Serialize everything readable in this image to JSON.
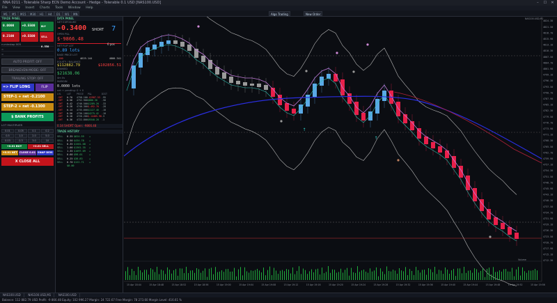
{
  "window": {
    "title": "NNA 0211 - Tolerable Sharp ECN Demo Account - Hedge - Tolerable 0.1 USD [NAS100.USD]",
    "controls": [
      "–",
      "☐",
      "✕"
    ]
  },
  "menu": [
    "File",
    "View",
    "Insert",
    "Charts",
    "Tools",
    "Window",
    "Help"
  ],
  "toolbar": {
    "timeframes": [
      "M1",
      "M5",
      "M15",
      "M30",
      "H1",
      "H4",
      "D1",
      "W1",
      "MN"
    ],
    "algo_label": "Algo Trading",
    "new_order_label": "New Order"
  },
  "left_panel": {
    "header": "TRADE PANEL",
    "quotes": [
      {
        "value": "0.0000",
        "change": "+0.5500",
        "btn": "BUY 0.550"
      },
      {
        "value": "0.2100",
        "change": "+0.5500",
        "btn": "SELL 0.550"
      }
    ],
    "lines": [
      "rr-minstop 005",
      "=",
      "="
    ],
    "auto_profit": "AUTO PROFIT: OFF",
    "breakeven": "BREAKEVEN MODE: OFF",
    "trailing": "TRAILING STOP: OFF",
    "flip_long": "=> FLIP LONG",
    "flip_extra": "FLIP",
    "step1": "STEP-1 + net -0.2100",
    "step2": "STEP-2 + net -0.1300",
    "bank_profits": "$ BANK PROFITS",
    "lot_label": "LOT MULTIPLIER",
    "lot_tiles": [
      "0.01",
      "0.05",
      "0.1",
      "0.2",
      "0.5",
      "1.0",
      "2.0",
      "5.0",
      "0.03",
      "0.3",
      "3.0",
      "10"
    ],
    "small_btns": [
      {
        "label": "+0.01 BUY",
        "color": "#0f7a3a"
      },
      {
        "label": "+0.01 SELL",
        "color": "#b8151c"
      }
    ],
    "small_btns2": [
      {
        "label": "+0.01 NET",
        "color": "#c78a12"
      },
      {
        "label": "CLOSE 0.01",
        "color": "#5a2d9a"
      },
      {
        "label": "SNAP DEIS",
        "color": "#2d37c8"
      }
    ],
    "close_all": "X CLOSE ALL"
  },
  "data_panel": {
    "header": "DATA PANEL",
    "net_label": "NET EXPOSURE",
    "net_value": "-0.3400",
    "side": "SHORT",
    "positions": "7",
    "open_pnl_label": "OPEN P&L",
    "open_pnl": "$-9866.48",
    "pnl_unit": "6 pos",
    "lots_label": "NET FLIP LOT",
    "lots": "0.89 lots",
    "lots_sub": "BASE PRICE LOT",
    "range_row": [
      "-100",
      "4619.144",
      "4800.341"
    ],
    "equity_label": "EQUITY / BALANCE",
    "equity": "$112882.79",
    "balance": "$102856.51",
    "bank_label": "BANKED",
    "bank": "$21638.06",
    "bank_sub": "4m 0s",
    "margin_label": "MARGIN",
    "margin": "0.0000 lots",
    "margin_sub": "net + pending: 0 + 0",
    "ladder_header": [
      "LVL",
      "LOT",
      "PRICE",
      "P&L",
      "DIST"
    ],
    "ladder": [
      [
        "-SHT",
        "0.70",
        "4758.100",
        "-$1987.53",
        "-95"
      ],
      [
        "-SHT",
        "0.56",
        "4752.900",
        "$886.30",
        "-58"
      ],
      [
        "-SHT",
        "0.42",
        "4746.500",
        "$1289.20",
        "-33"
      ],
      [
        "-SHT",
        "0.28",
        "4740.300",
        "$-492.70",
        "-28"
      ],
      [
        "-SHT",
        "0.14",
        "4735.600",
        "$1127.40",
        "-18"
      ],
      [
        "-SHT",
        "0.50",
        "4730.100",
        "$4275.42",
        "-10"
      ],
      [
        "-SHT",
        "0.10",
        "4726.200",
        "$-14485.98",
        "-3"
      ],
      [
        "-SHT",
        "0.36",
        "4722.800",
        "$9340.28",
        "-1"
      ]
    ],
    "short_summary": "0.34 SHORT   Open: -9866.48",
    "history_header": "TRADE HISTORY",
    "history": [
      [
        "SELL",
        "0.35",
        "$624.59",
        "+"
      ],
      [
        "SELL",
        "0.50",
        "$434.78",
        "+"
      ],
      [
        "SELL",
        "0.35",
        "$1581.08",
        "+"
      ],
      [
        "SELL",
        "1.00",
        "$1361.35",
        "+"
      ],
      [
        "SELL",
        "1.35",
        "$1097.09",
        "+"
      ],
      [
        "SELL",
        "0.60",
        "$98.01",
        "+"
      ],
      [
        "SELL",
        "0.25",
        "$38.83",
        "+"
      ],
      [
        "SELL",
        "0.70",
        "$122.71",
        "+"
      ]
    ],
    "history_total": "$0.00"
  },
  "chart": {
    "price_labels": [
      "4824.30",
      "4821.50",
      "4818.70",
      "4815.90",
      "4813.10",
      "4810.30",
      "4807.50",
      "4804.70",
      "4801.90",
      "4799.10",
      "4796.30",
      "4793.50",
      "4790.70",
      "4787.90",
      "4785.10",
      "4782.30",
      "4779.50",
      "4776.70",
      "4773.90",
      "4771.10",
      "4768.30",
      "4765.50",
      "4762.70",
      "4759.90",
      "4757.10",
      "4754.30",
      "4751.50",
      "4748.70",
      "4745.90",
      "4743.10",
      "4740.30",
      "4737.50",
      "4734.70",
      "4731.90",
      "4729.10",
      "4726.30",
      "4723.50",
      "4720.70",
      "4717.90",
      "4715.10",
      "4712.30"
    ],
    "time_labels": [
      "15 Apr 18:44",
      "15 Apr 18:48",
      "15 Apr 18:52",
      "15 Apr 18:56",
      "15 Apr 19:00",
      "15 Apr 19:04",
      "15 Apr 19:08",
      "15 Apr 19:12",
      "15 Apr 19:16",
      "15 Apr 19:20",
      "15 Apr 19:24",
      "15 Apr 19:28",
      "15 Apr 19:32",
      "15 Apr 19:36",
      "15 Apr 19:40",
      "15 Apr 19:44",
      "15 Apr 19:48",
      "15 Apr 19:52",
      "15 Apr 19:56"
    ],
    "volume_label": "Volume",
    "corner_label": "NAS100.USD,M1",
    "colors": {
      "bull": "#5aa9e6",
      "bear": "#e8204a",
      "neutral": "#9a9a9a",
      "ma": "#2a2ee0",
      "band": "#b9b9b9",
      "ema": "#c07ad8",
      "slow": "#b0213a",
      "fast": "#2fbfb0"
    }
  },
  "tabs": [
    "NAS100.USD",
    "NAS100.USD,M1",
    "NAS100.USD"
  ],
  "status": "Balance: 112 882.79 USD  Profit: -9 866.48  Equity: 102 996.27  Margin: 24 722.67  Free Margin: 78 273.60  Margin Level: 416.61 %"
}
